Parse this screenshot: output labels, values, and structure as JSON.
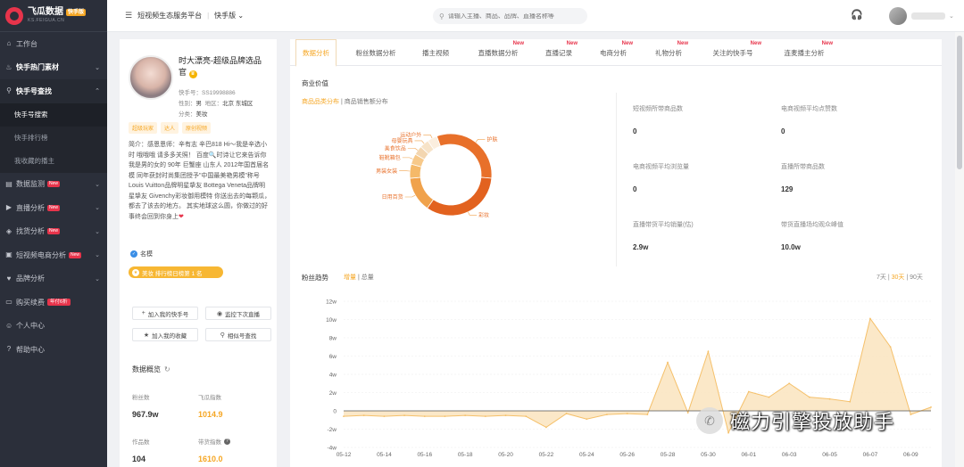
{
  "brand": {
    "name": "飞瓜数据",
    "badge": "快手版",
    "domain": "KS.FEIGUA.CN"
  },
  "sidebar": {
    "items": [
      {
        "icon": "home-icon",
        "label": "工作台"
      },
      {
        "icon": "fire-icon",
        "label": "快手热门素材"
      },
      {
        "icon": "search-icon",
        "label": "快手号查找"
      },
      {
        "label": "快手号搜索"
      },
      {
        "label": "快手排行榜"
      },
      {
        "label": "我收藏的播主"
      },
      {
        "icon": "chart-icon",
        "label": "数据监测",
        "badge": "New"
      },
      {
        "icon": "live-icon",
        "label": "直播分析",
        "badge": "New"
      },
      {
        "icon": "goods-icon",
        "label": "找货分析",
        "badge": "New"
      },
      {
        "icon": "video-icon",
        "label": "短视频电商分析",
        "badge": "New"
      },
      {
        "icon": "heart-icon",
        "label": "品牌分析"
      },
      {
        "icon": "cart-icon",
        "label": "购买续费",
        "badge": "年付6折"
      },
      {
        "icon": "user-icon",
        "label": "个人中心"
      },
      {
        "icon": "help-icon",
        "label": "帮助中心"
      }
    ]
  },
  "topbar": {
    "platform": "短视频生态服务平台",
    "version": "快手版",
    "search_placeholder": "请输入主播、商品、品牌、直播名称等"
  },
  "profile": {
    "name": "时大漂亮-超级品牌选品官",
    "id_label": "快手号：",
    "id_value": "SS19998886",
    "gender_label": "性别：",
    "gender_value": "男",
    "region_label": "地区：",
    "region_value": "北京 东城区",
    "category_label": "分类：",
    "category_value": "美妆",
    "tags": [
      "超级玩家",
      "达人",
      "原创视频"
    ],
    "bio_1": "简介：感恩恩师：辛有志 辛巴818 Hi～我是辛选小时 哦哦哦 请多多关照！ 百度🔍时诗",
    "bio_2": "让它来告诉你我是男的女的 90年 巨蟹座 山东人 2012年国首届名模 同年获封时尚集团授予\"中国最美艳男模\"称号 Louis Vuitton品牌明星挚友 Bottega Veneta品牌明星挚友 Givenchy彩妆御用模特 你送出去的每颗瓜，都去了该去的地方。 其实地球这么圆，你做过的好事终会回到你身上",
    "heart": "❤",
    "verified": "名模",
    "rank_text": "美妆 排行榜日榜第 1 名",
    "actions": [
      "加入我的快手号",
      "监控下次直播",
      "加入我的收藏",
      "相似号查找"
    ],
    "overview_title": "数据概览",
    "stats": [
      {
        "label": "粉丝数",
        "value": "967.9w"
      },
      {
        "label": "飞瓜指数",
        "value": "1014.9"
      },
      {
        "label": "作品数",
        "value": "104"
      },
      {
        "label": "带货指数",
        "value": "1610.0"
      }
    ]
  },
  "tabs": [
    {
      "label": "数据分析"
    },
    {
      "label": "粉丝数据分析"
    },
    {
      "label": "播主视频"
    },
    {
      "label": "直播数据分析",
      "new": "New"
    },
    {
      "label": "直播记录",
      "new": "New"
    },
    {
      "label": "电商分析",
      "new": "New"
    },
    {
      "label": "礼物分析",
      "new": "New"
    },
    {
      "label": "关注的快手号",
      "new": "New"
    },
    {
      "label": "连麦播主分析",
      "new": "New"
    }
  ],
  "commerce": {
    "title": "商业价值",
    "subtab_active": "商品品类分布",
    "subtab_sep": " | ",
    "subtab_other": "商品销售额分布",
    "donut_labels": [
      "护肤",
      "日用百货",
      "男装女装",
      "鞋靴箱包",
      "美食饮品",
      "母婴玩具",
      "运动户外",
      "彩妆"
    ],
    "donut_colors": [
      "#e8702a",
      "#f0a24c",
      "#f5b969",
      "#f7c98a",
      "#f3d6b0",
      "#f7e3c8",
      "#fbeede",
      "#e2621f"
    ],
    "metrics": [
      {
        "label": "短视频所带商品数",
        "value": "0"
      },
      {
        "label": "电商视频平均点赞数",
        "value": "0"
      },
      {
        "label": "电商视频平均浏览量",
        "value": "0"
      },
      {
        "label": "直播所带商品数",
        "value": "129"
      },
      {
        "label": "直播带货平均销量(估)",
        "value": "2.9w"
      },
      {
        "label": "带货直播场均观众峰值",
        "value": "10.0w"
      }
    ]
  },
  "fans": {
    "title": "粉丝趋势",
    "mode_active": "增量",
    "mode_sep": " | ",
    "mode_other": "总量",
    "range_7": "7天",
    "range_30": "30天",
    "range_90": "90天",
    "range_sep": " | "
  },
  "chart_data": {
    "type": "area",
    "title": "粉丝趋势",
    "y_unit": "w",
    "ylim": [
      -4,
      12
    ],
    "yticks": [
      "12w",
      "10w",
      "8w",
      "6w",
      "4w",
      "2w",
      "0",
      "-2w",
      "-4w"
    ],
    "x_tick_labels": [
      "05-12",
      "05-14",
      "05-16",
      "05-18",
      "05-20",
      "05-22",
      "05-24",
      "05-26",
      "05-28",
      "05-30",
      "06-01",
      "06-03",
      "06-05",
      "06-07",
      "06-09"
    ],
    "x": [
      "05-12",
      "05-13",
      "05-14",
      "05-15",
      "05-16",
      "05-17",
      "05-18",
      "05-19",
      "05-20",
      "05-21",
      "05-22",
      "05-23",
      "05-24",
      "05-25",
      "05-26",
      "05-27",
      "05-28",
      "05-29",
      "05-30",
      "05-31",
      "06-01",
      "06-02",
      "06-03",
      "06-04",
      "06-05",
      "06-06",
      "06-07",
      "06-08",
      "06-09",
      "06-10"
    ],
    "values": [
      -0.6,
      -0.5,
      -0.6,
      -0.5,
      -0.6,
      -0.6,
      -0.5,
      -0.6,
      -0.5,
      -0.6,
      -1.8,
      -0.3,
      -0.9,
      -0.4,
      -0.3,
      -0.4,
      5.3,
      -0.2,
      6.5,
      -2.4,
      2.1,
      1.5,
      3.0,
      1.5,
      1.3,
      1.0,
      10.1,
      7.0,
      -0.4,
      0.4
    ],
    "color": "#f5c06a",
    "grid": true
  }
}
